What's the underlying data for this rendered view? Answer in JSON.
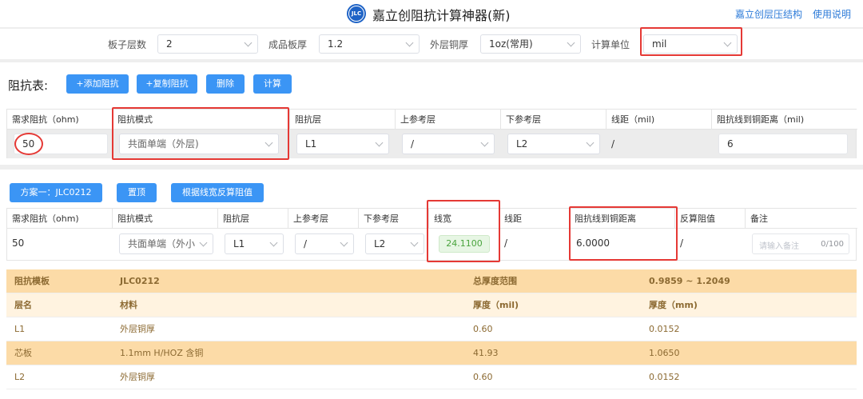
{
  "header": {
    "title": "嘉立创阻抗计算神器(新)",
    "logo_text": "JLC",
    "links": [
      "嘉立创层压结构",
      "使用说明"
    ]
  },
  "settings": {
    "layers_label": "板子层数",
    "layers_value": "2",
    "thickness_label": "成品板厚",
    "thickness_value": "1.2",
    "copper_label": "外层铜厚",
    "copper_value": "1oz(常用)",
    "unit_label": "计算单位",
    "unit_value": "mil"
  },
  "impedance_table": {
    "title": "阻抗表:",
    "buttons": [
      "+添加阻抗",
      "+复制阻抗",
      "删除",
      "计算"
    ],
    "headers": [
      "需求阻抗（ohm)",
      "阻抗模式",
      "阻抗层",
      "上参考层",
      "下参考层",
      "线距（mil)",
      "阻抗线到铜距离（mil)"
    ],
    "row": {
      "impedance": "50",
      "mode": "共面单端（外层)",
      "layer": "L1",
      "top_ref": "/",
      "bottom_ref": "L2",
      "spacing": "/",
      "copper_distance": "6"
    }
  },
  "solution": {
    "buttons": [
      "方案一：JLC0212",
      "置顶",
      "根据线宽反算阻值"
    ],
    "headers": [
      "需求阻抗（ohm)",
      "阻抗模式",
      "阻抗层",
      "上参考层",
      "下参考层",
      "线宽",
      "线距",
      "阻抗线到铜距离",
      "反算阻值",
      "备注"
    ],
    "row": {
      "impedance": "50",
      "mode": "共面单端（外小",
      "layer": "L1",
      "top_ref": "/",
      "bottom_ref": "L2",
      "width": "24.1100",
      "spacing": "/",
      "copper_distance": "6.0000",
      "back_calc": "/",
      "remark_placeholder": "请输入备注",
      "remark_counter": "0/100"
    },
    "stackup": {
      "template_label": "阻抗模板",
      "template_value": "JLC0212",
      "total_label": "总厚度范围",
      "total_value": "0.9859 ~ 1.2049",
      "col_headers": [
        "层名",
        "材料",
        "厚度（mil)",
        "厚度（mm)"
      ],
      "rows": [
        {
          "name": "L1",
          "material": "外层铜厚",
          "mil": "0.60",
          "mm": "0.0152"
        },
        {
          "name": "芯板",
          "material": "1.1mm H/HOZ 含铜",
          "mil": "41.93",
          "mm": "1.0650"
        },
        {
          "name": "L2",
          "material": "外层铜厚",
          "mil": "0.60",
          "mm": "0.0152"
        }
      ]
    }
  },
  "colors": {
    "accent_blue": "#3b95f5",
    "highlight_red": "#e53935",
    "stackup_orange": "#fcdba7",
    "width_green": "#4aa43e"
  }
}
